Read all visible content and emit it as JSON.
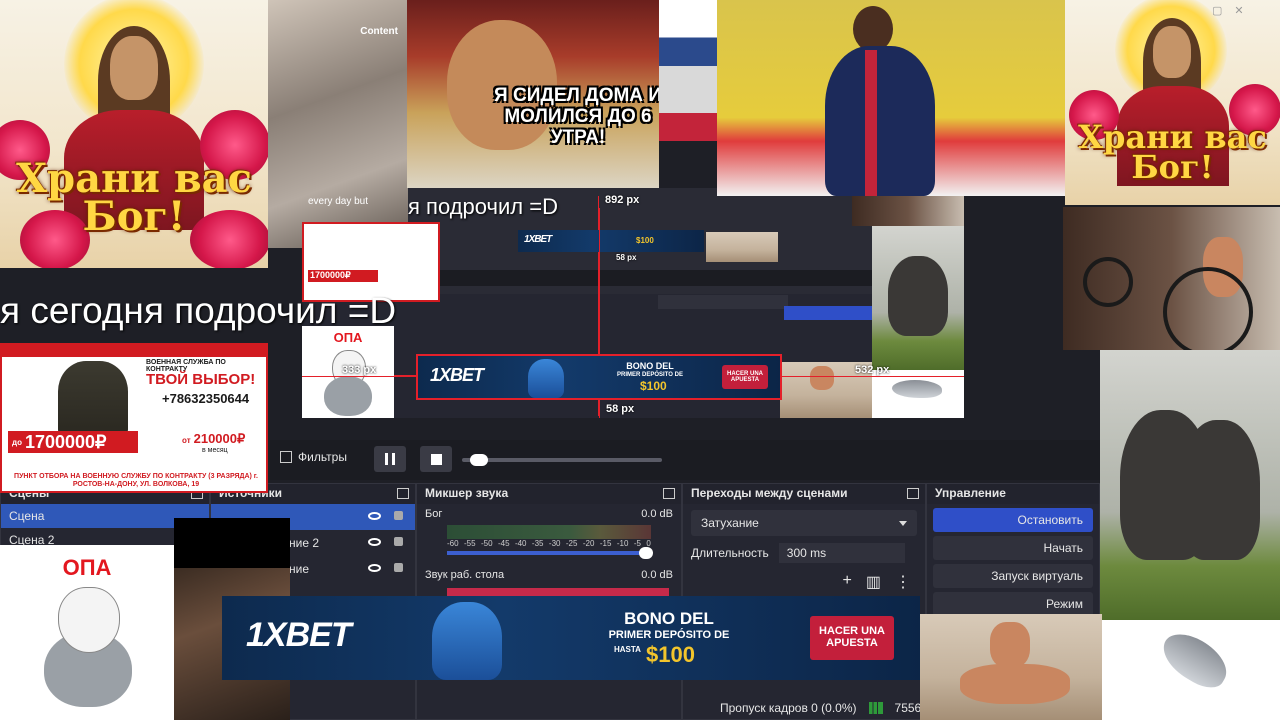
{
  "obs": {
    "toolbar": {
      "filters_label": "Фильтры"
    },
    "docks": {
      "scenes": {
        "title": "Сцены",
        "items": [
          "Сцена",
          "Сцена 2"
        ]
      },
      "sources": {
        "title": "Источники",
        "items": [
          "",
          "ние 2",
          "ние"
        ]
      },
      "mixer": {
        "title": "Микшер звука",
        "channels": [
          {
            "name": "Бог",
            "level": "0.0 dB"
          },
          {
            "name": "Звук раб. стола",
            "level": "0.0 dB"
          }
        ],
        "ticks": [
          "-60",
          "-55",
          "-50",
          "-45",
          "-40",
          "-35",
          "-30",
          "-25",
          "-20",
          "-15",
          "-10",
          "-5",
          "0"
        ]
      },
      "transitions": {
        "title": "Переходы между сценами",
        "selected": "Затухание",
        "duration_label": "Длительность",
        "duration_value": "300 ms"
      },
      "controls": {
        "title": "Управление",
        "buttons": [
          "Остановить",
          "Начать",
          "Запуск виртуаль",
          "Режим"
        ]
      }
    },
    "status": {
      "dropped_frames": "Пропуск кадров 0 (0.0%)",
      "bitrate": "7556"
    }
  },
  "collage": {
    "blessing_text": "Храни вас Бог!",
    "tiktok_caption": "every day but",
    "watermark": "Content",
    "cartoon_caption": "Я СИДЕЛ ДОМА И МОЛИЛСЯ ДО 6 УТРА!",
    "caption_big": "я сегодня подрочил =D",
    "caption_mid": "я подрочил =D",
    "dimensions": {
      "top": "892 px",
      "left": "333 px",
      "right": "532 px",
      "bottom": "58 px",
      "small_bottom": "58 px"
    },
    "opa_text": "ОПА",
    "army_ad": {
      "header": "ВОЕННАЯ СЛУЖБА ПО КОНТРАКТУ",
      "choice": "ТВОЙ ВЫБОР!",
      "phone": "+78632350644",
      "price_prefix": "до",
      "price": "1700000₽",
      "salary_prefix": "от",
      "salary": "210000₽",
      "salary_note": "в месяц",
      "footer": "ПУНКТ ОТБОРА НА ВОЕННУЮ СЛУЖБУ ПО КОНТРАКТУ (3 РАЗРЯДА) г. РОСТОВ-НА-ДОНУ, УЛ. ВОЛКОВА, 19"
    },
    "bet_ad": {
      "logo": "1XBET",
      "line1": "BONO DEL",
      "line2": "PRIMER DEPÓSITO DE",
      "hasta": "HASTA",
      "amount": "$100",
      "button": "HACER UNA APUESTA"
    }
  }
}
